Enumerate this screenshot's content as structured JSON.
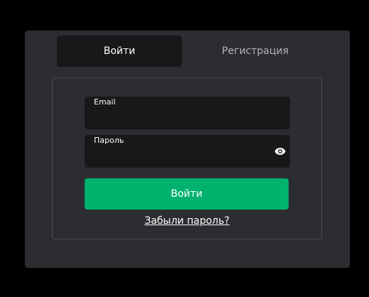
{
  "tabs": {
    "login_label": "Войти",
    "register_label": "Регистрация"
  },
  "form": {
    "email": {
      "label": "Email",
      "value": "",
      "placeholder": ""
    },
    "password": {
      "label": "Пароль",
      "value": "",
      "placeholder": ""
    },
    "submit_label": "Войти",
    "forgot_label": "Забыли пароль?"
  },
  "icons": {
    "password_toggle": "eye-icon"
  },
  "colors": {
    "page_background": "#000000",
    "panel_background": "#2c2d30",
    "field_background": "#18181a",
    "accent": "#00b26e",
    "inactive_tab_text": "#b3b4b7"
  }
}
